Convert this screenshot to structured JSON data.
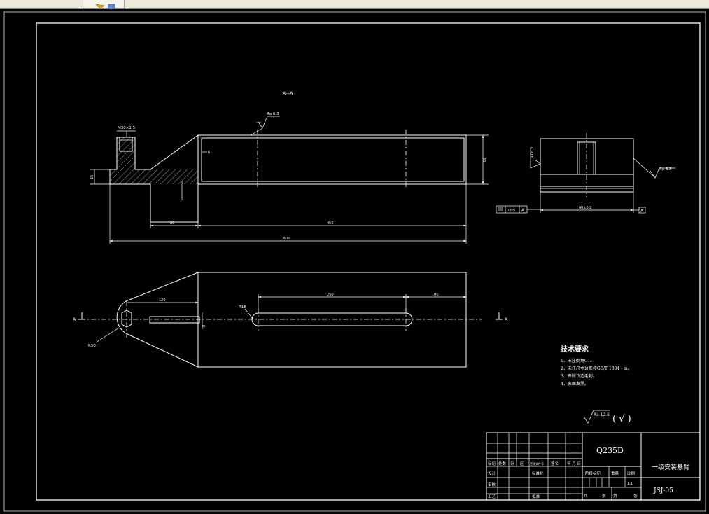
{
  "section_label": "A—A",
  "roughness": {
    "top_face": "Ra 6.3",
    "side_left": "Ra 6.3",
    "side_right": "Ra 6.3",
    "general": "Ra 12.5",
    "general_paren": "( √ )"
  },
  "dimensions": {
    "thread": "M30×1.5",
    "left_height": "15",
    "wall": "6",
    "gap": "1",
    "height": "28",
    "d80": "80",
    "d450": "450",
    "d600": "600",
    "d120": "120",
    "d250": "250",
    "d100": "100",
    "slot": "8",
    "r18": "R18",
    "r50": "R50",
    "end_width": "60±0.2",
    "flatness": "0.05",
    "datum": "A"
  },
  "section_marks": {
    "left": "A",
    "right": "A"
  },
  "tech_req": {
    "title": "技术要求",
    "items": [
      "1、未注倒角C1。",
      "2、未注尺寸公差按GB/T 1804 - m。",
      "3、去除飞边毛刺。",
      "4、表面发黑。"
    ]
  },
  "title_block": {
    "material": "Q235D",
    "part_name": "一级安装悬臂",
    "drawing_no": "JSJ-05",
    "scale": "1:1",
    "row_labels": [
      "标记",
      "设计",
      "审核",
      "工艺"
    ],
    "header_cells": [
      "处数",
      "分",
      "区",
      "更改文件号",
      "签名",
      "年 月 日"
    ],
    "std_label": "标准化",
    "approve_label": "批准",
    "stage_label": "阶段标记",
    "weight_label": "重量",
    "scale_label": "比例",
    "sheet_info": [
      "共",
      "张",
      "第",
      "张"
    ]
  }
}
